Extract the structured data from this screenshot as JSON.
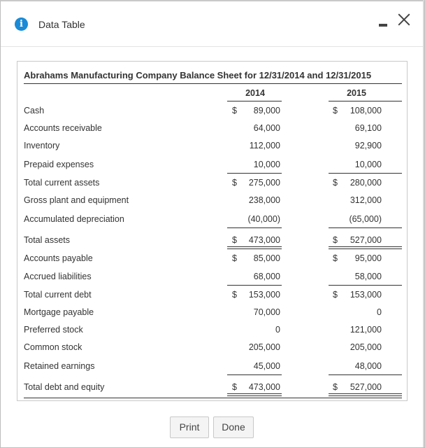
{
  "window": {
    "title": "Data Table",
    "info_icon": "info-icon",
    "minimize_icon": "minimize-icon",
    "close_icon": "close-icon"
  },
  "table": {
    "title": "Abrahams Manufacturing Company Balance Sheet for 12/31/2014 and 12/31/2015",
    "columns": [
      "2014",
      "2015"
    ],
    "rows": [
      {
        "label": "Cash",
        "v2014": "89,000",
        "v2015": "108,000",
        "dollar": true
      },
      {
        "label": "Accounts receivable",
        "v2014": "64,000",
        "v2015": "69,100"
      },
      {
        "label": "Inventory",
        "v2014": "112,000",
        "v2015": "92,900"
      },
      {
        "label": "Prepaid expenses",
        "v2014": "10,000",
        "v2015": "10,000"
      },
      {
        "label": "Total current assets",
        "v2014": "275,000",
        "v2015": "280,000",
        "dollar": true
      },
      {
        "label": "Gross plant and equipment",
        "v2014": "238,000",
        "v2015": "312,000"
      },
      {
        "label": "Accumulated depreciation",
        "v2014": "(40,000)",
        "v2015": "(65,000)"
      },
      {
        "label": "Total assets",
        "v2014": "473,000",
        "v2015": "527,000",
        "dollar": true
      },
      {
        "label": "Accounts payable",
        "v2014": "85,000",
        "v2015": "95,000",
        "dollar": true
      },
      {
        "label": "Accrued liabilities",
        "v2014": "68,000",
        "v2015": "58,000"
      },
      {
        "label": "Total current debt",
        "v2014": "153,000",
        "v2015": "153,000",
        "dollar": true
      },
      {
        "label": "Mortgage payable",
        "v2014": "70,000",
        "v2015": "0"
      },
      {
        "label": "Preferred stock",
        "v2014": "0",
        "v2015": "121,000"
      },
      {
        "label": "Common stock",
        "v2014": "205,000",
        "v2015": "205,000"
      },
      {
        "label": "Retained earnings",
        "v2014": "45,000",
        "v2015": "48,000"
      },
      {
        "label": "Total debt and equity",
        "v2014": "473,000",
        "v2015": "527,000",
        "dollar": true
      }
    ],
    "currency_symbol": "$"
  },
  "buttons": {
    "print": "Print",
    "done": "Done"
  }
}
